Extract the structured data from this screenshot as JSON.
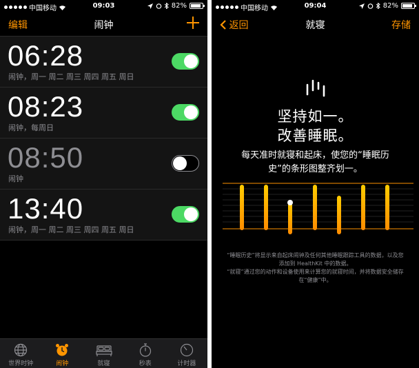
{
  "left": {
    "status": {
      "carrier": "中国移动",
      "time": "09:03",
      "battery": "82%"
    },
    "nav": {
      "edit": "编辑",
      "title": "闹钟"
    },
    "alarms": [
      {
        "time": "06:28",
        "label": "闹钟，周一 周二 周三 周四 周五 周日",
        "on": true
      },
      {
        "time": "08:23",
        "label": "闹钟，每周日",
        "on": true
      },
      {
        "time": "08:50",
        "label": "闹钟",
        "on": false
      },
      {
        "time": "13:40",
        "label": "闹钟，周一 周二 周三 周四 周五 周日",
        "on": true
      }
    ],
    "tabs": [
      {
        "label": "世界时钟",
        "icon": "globe-icon"
      },
      {
        "label": "闹钟",
        "icon": "alarm-clock-icon",
        "active": true
      },
      {
        "label": "就寝",
        "icon": "bed-icon"
      },
      {
        "label": "秒表",
        "icon": "stopwatch-icon"
      },
      {
        "label": "计时器",
        "icon": "timer-icon"
      }
    ]
  },
  "right": {
    "status": {
      "carrier": "中国移动",
      "time": "09:04",
      "battery": "82%"
    },
    "nav": {
      "back": "返回",
      "title": "就寝",
      "save": "存储"
    },
    "hero": {
      "icon": "sleep-bars-icon",
      "title_line1": "坚持如一。",
      "title_line2": "改善睡眠。",
      "subtitle": "每天准时就寝和起床，使您的“睡眠历史”的条形图整齐划一。"
    },
    "footnote_1": "“睡眠历史”将显示来自起床闹钟及任何其他睡眠跟踪工具的数据，以及您添加到 HealthKit 中的数据。",
    "footnote_2": "“就寝”通过您的动作和设备使用来计算您的就寝时间，并将数据安全储存在“健康”中。"
  },
  "colors": {
    "accent": "#ff9500",
    "toggle_on": "#4cd964",
    "secondary_text": "#8e8e93"
  }
}
